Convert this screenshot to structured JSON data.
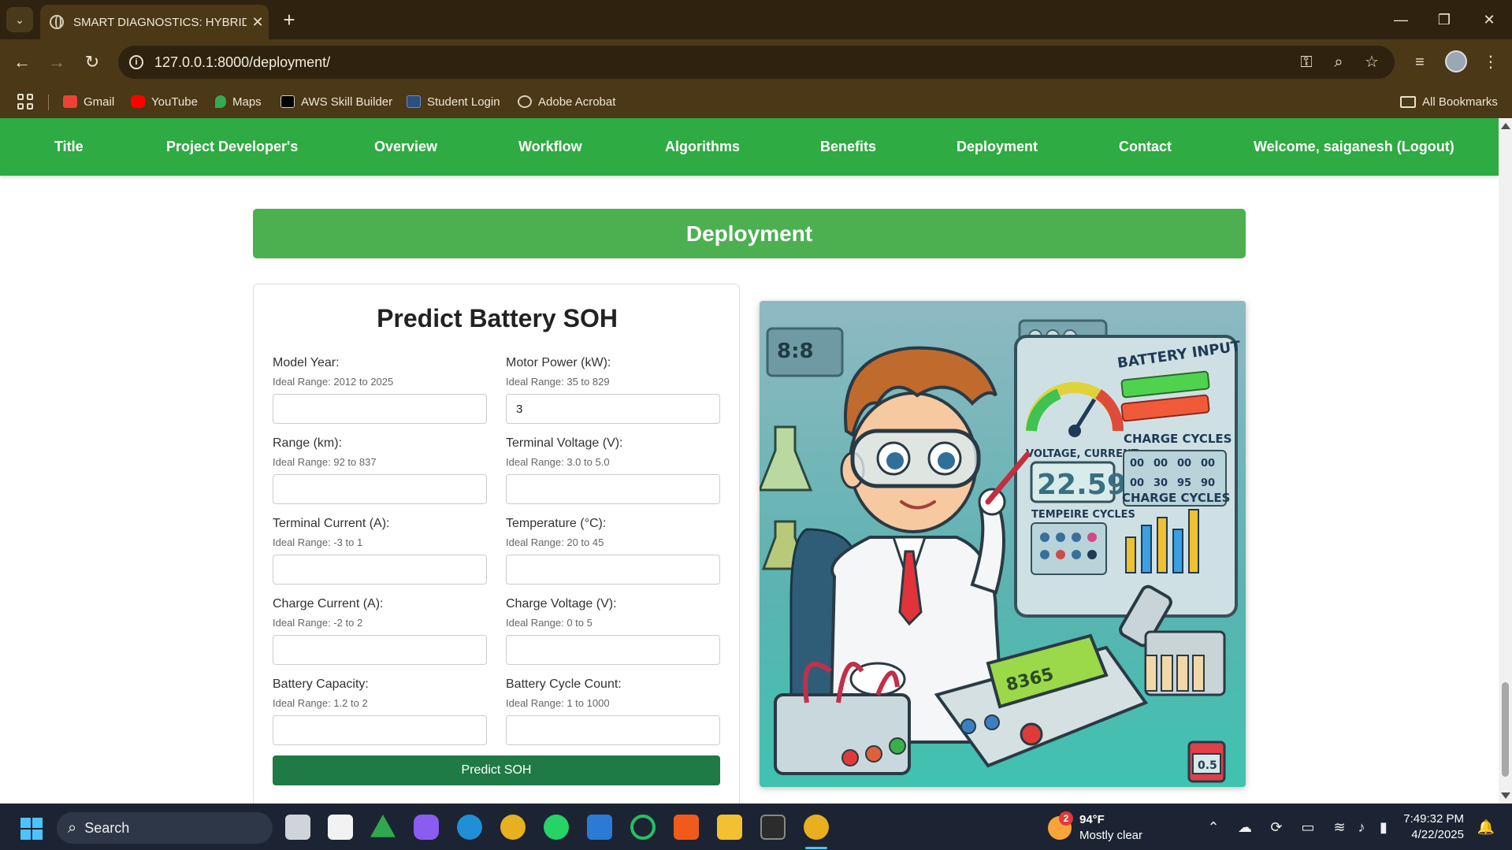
{
  "browser": {
    "tab_title": "SMART DIAGNOSTICS: HYBRID",
    "url": "127.0.0.1:8000/deployment/",
    "bookmarks": [
      {
        "label": "Gmail",
        "icon": "gmail-icon",
        "color": "#ea4335"
      },
      {
        "label": "YouTube",
        "icon": "youtube-icon",
        "color": "#ff0000"
      },
      {
        "label": "Maps",
        "icon": "maps-icon",
        "color": "#34a853"
      },
      {
        "label": "AWS Skill Builder",
        "icon": "aws-icon",
        "color": "#232f3e"
      },
      {
        "label": "Student Login",
        "icon": "student-login-icon",
        "color": "#3b6fb6"
      },
      {
        "label": "Adobe Acrobat",
        "icon": "globe-icon",
        "color": "#cccccc"
      }
    ],
    "all_bookmarks_label": "All Bookmarks"
  },
  "site_nav": {
    "items": [
      "Title",
      "Project Developer's",
      "Overview",
      "Workflow",
      "Algorithms",
      "Benefits",
      "Deployment",
      "Contact",
      "Welcome, saiganesh (Logout)"
    ],
    "color": "#2eab42"
  },
  "page": {
    "section_title": "Deployment",
    "form_title": "Predict Battery SOH",
    "fields": [
      {
        "label": "Model Year:",
        "hint": "Ideal Range: 2012 to 2025",
        "value": ""
      },
      {
        "label": "Motor Power (kW):",
        "hint": "Ideal Range: 35 to 829",
        "value": "3"
      },
      {
        "label": "Range (km):",
        "hint": "Ideal Range: 92 to 837",
        "value": ""
      },
      {
        "label": "Terminal Voltage (V):",
        "hint": "Ideal Range: 3.0 to 5.0",
        "value": ""
      },
      {
        "label": "Terminal Current (A):",
        "hint": "Ideal Range: -3 to 1",
        "value": ""
      },
      {
        "label": "Temperature (°C):",
        "hint": "Ideal Range: 20 to 45",
        "value": ""
      },
      {
        "label": "Charge Current (A):",
        "hint": "Ideal Range: -2 to 2",
        "value": ""
      },
      {
        "label": "Charge Voltage (V):",
        "hint": "Ideal Range: 0 to 5",
        "value": ""
      },
      {
        "label": "Battery Capacity:",
        "hint": "Ideal Range: 1.2 to 2",
        "value": ""
      },
      {
        "label": "Battery Cycle Count:",
        "hint": "Ideal Range: 1 to 1000",
        "value": ""
      }
    ],
    "submit_label": "Predict SOH",
    "illustration": {
      "panel_title": "BATTERY INPUT",
      "label_voltage": "VOLTAGE, CURRENT",
      "label_cycles": "CHARGE CYCLES",
      "label_cycles_2": "CHARGE CYCLES",
      "label_temp": "TEMPEIRE CYCLES",
      "readout": "22.59",
      "wall_display": "8:8",
      "device_screen": "8365",
      "jar_label": "0.5",
      "cycle_digits": [
        "00",
        "00",
        "00",
        "00",
        "00",
        "30",
        "95",
        "90"
      ]
    }
  },
  "taskbar": {
    "search_label": "Search",
    "weather_temp": "94°F",
    "weather_desc": "Mostly clear",
    "weather_badge": "2",
    "time": "7:49:32 PM",
    "date": "4/22/2025"
  }
}
